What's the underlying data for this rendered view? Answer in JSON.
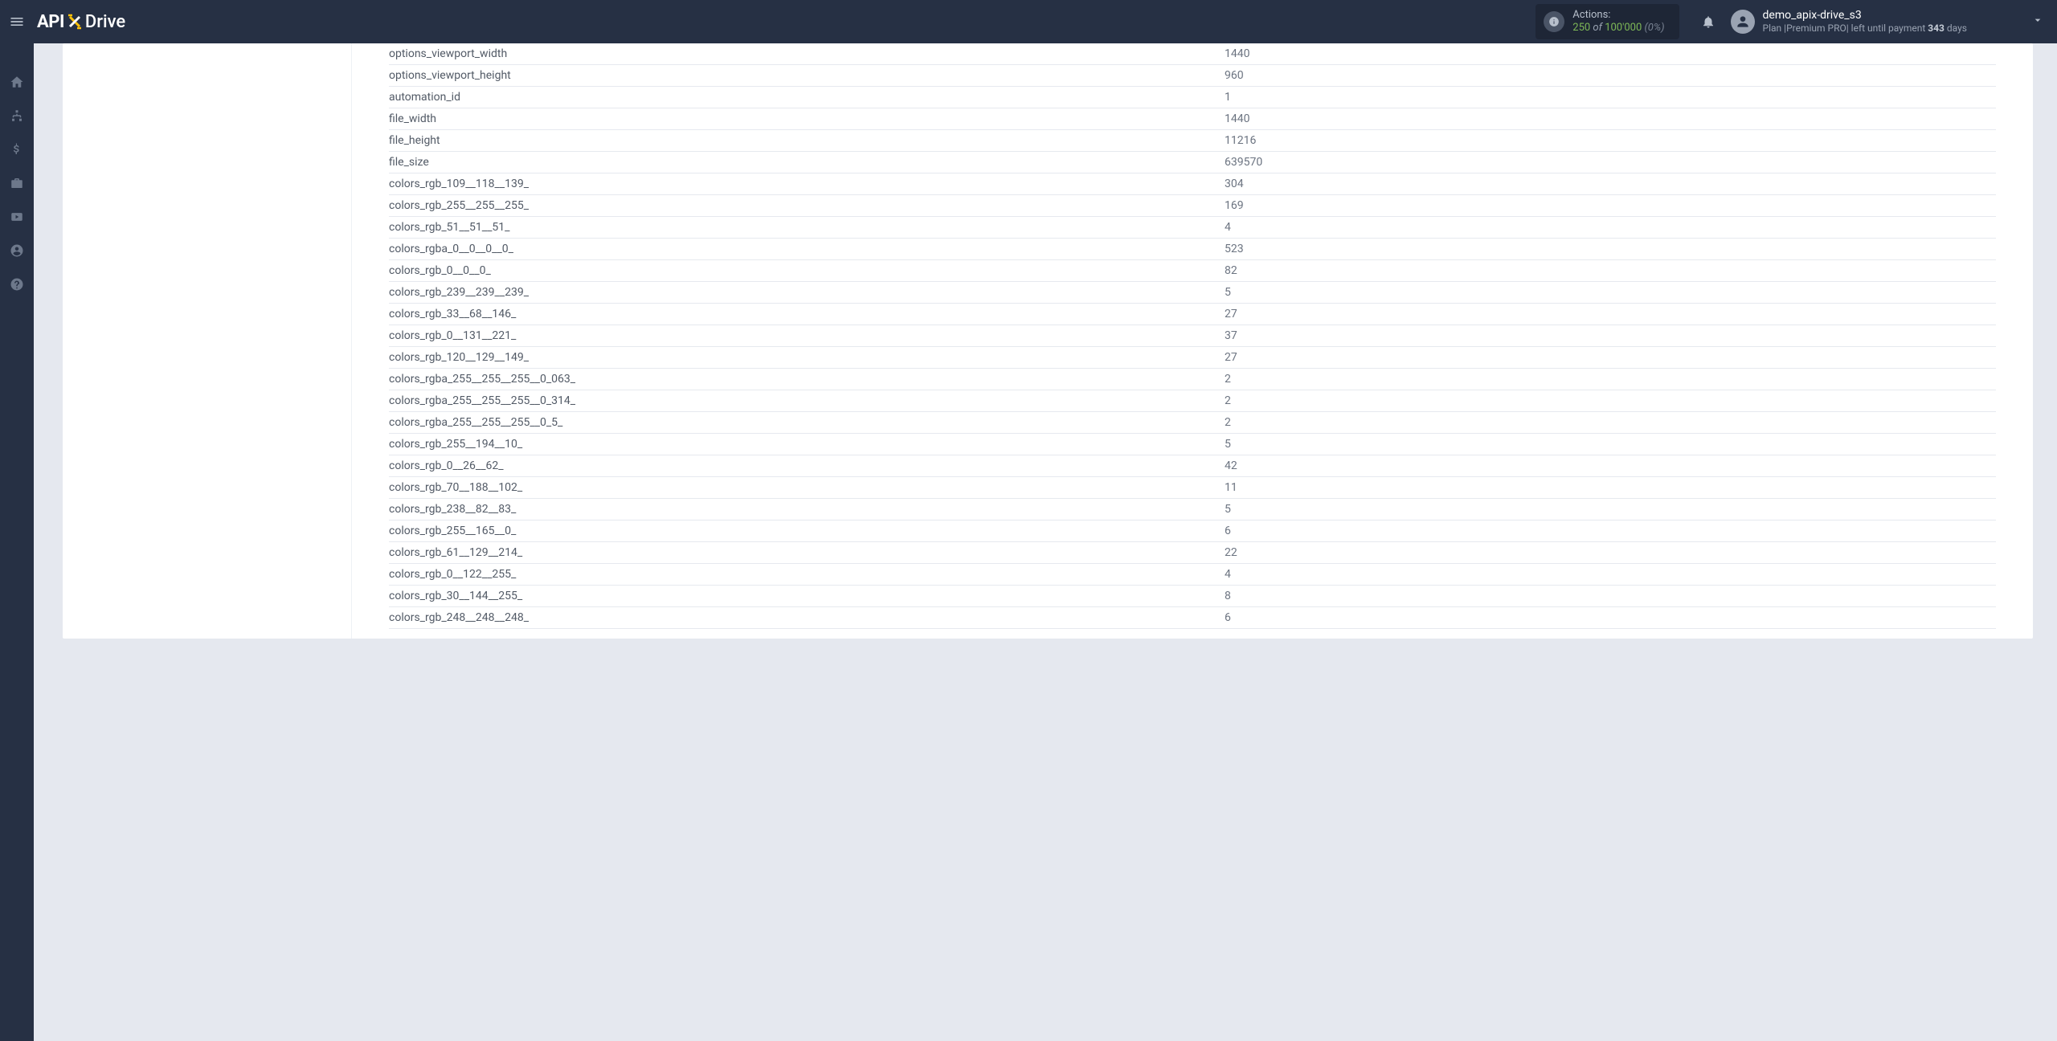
{
  "logo": {
    "part1": "API",
    "part2": "Drive"
  },
  "header": {
    "actions_label": "Actions:",
    "actions_used": "250",
    "actions_of": " of ",
    "actions_total": "100'000",
    "actions_pct": " (0%)",
    "user_name": "demo_apix-drive_s3",
    "plan_prefix": "Plan |",
    "plan_name": "Premium PRO",
    "plan_mid": "| left until payment ",
    "plan_days": "343",
    "plan_suffix": " days"
  },
  "rows": [
    {
      "k": "options_viewport_width",
      "v": "1440"
    },
    {
      "k": "options_viewport_height",
      "v": "960"
    },
    {
      "k": "automation_id",
      "v": "1"
    },
    {
      "k": "file_width",
      "v": "1440"
    },
    {
      "k": "file_height",
      "v": "11216"
    },
    {
      "k": "file_size",
      "v": "639570"
    },
    {
      "k": "colors_rgb_109__118__139_",
      "v": "304"
    },
    {
      "k": "colors_rgb_255__255__255_",
      "v": "169"
    },
    {
      "k": "colors_rgb_51__51__51_",
      "v": "4"
    },
    {
      "k": "colors_rgba_0__0__0__0_",
      "v": "523"
    },
    {
      "k": "colors_rgb_0__0__0_",
      "v": "82"
    },
    {
      "k": "colors_rgb_239__239__239_",
      "v": "5"
    },
    {
      "k": "colors_rgb_33__68__146_",
      "v": "27"
    },
    {
      "k": "colors_rgb_0__131__221_",
      "v": "37"
    },
    {
      "k": "colors_rgb_120__129__149_",
      "v": "27"
    },
    {
      "k": "colors_rgba_255__255__255__0_063_",
      "v": "2"
    },
    {
      "k": "colors_rgba_255__255__255__0_314_",
      "v": "2"
    },
    {
      "k": "colors_rgba_255__255__255__0_5_",
      "v": "2"
    },
    {
      "k": "colors_rgb_255__194__10_",
      "v": "5"
    },
    {
      "k": "colors_rgb_0__26__62_",
      "v": "42"
    },
    {
      "k": "colors_rgb_70__188__102_",
      "v": "11"
    },
    {
      "k": "colors_rgb_238__82__83_",
      "v": "5"
    },
    {
      "k": "colors_rgb_255__165__0_",
      "v": "6"
    },
    {
      "k": "colors_rgb_61__129__214_",
      "v": "22"
    },
    {
      "k": "colors_rgb_0__122__255_",
      "v": "4"
    },
    {
      "k": "colors_rgb_30__144__255_",
      "v": "8"
    },
    {
      "k": "colors_rgb_248__248__248_",
      "v": "6"
    }
  ]
}
